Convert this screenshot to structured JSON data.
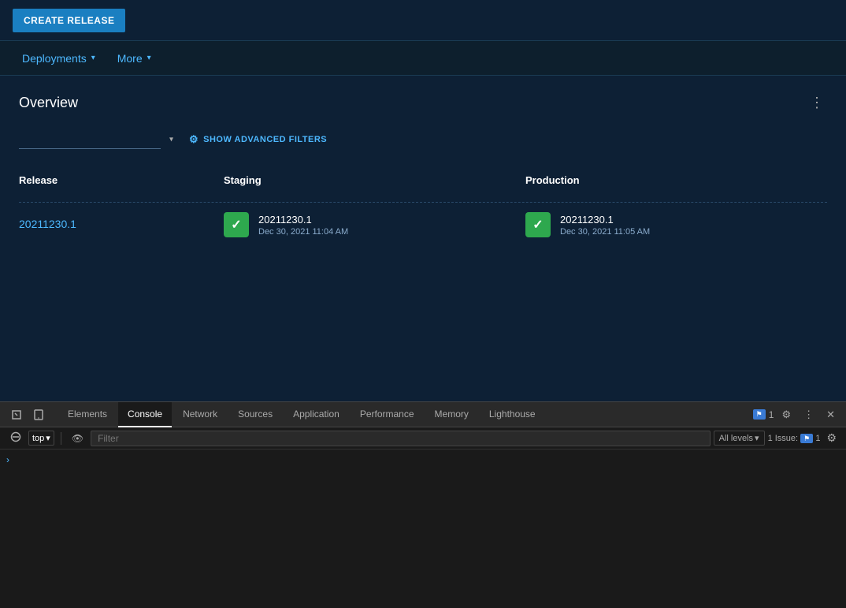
{
  "topbar": {
    "create_release_label": "CREATE RELEASE"
  },
  "navbar": {
    "items": [
      {
        "id": "deployments",
        "label": "Deployments",
        "hasDropdown": true
      },
      {
        "id": "more",
        "label": "More",
        "hasDropdown": true
      }
    ]
  },
  "overview": {
    "title": "Overview",
    "filters": {
      "dropdown_placeholder": "",
      "advanced_filters_label": "SHOW ADVANCED FILTERS"
    },
    "table": {
      "headers": [
        "Release",
        "Staging",
        "Production"
      ],
      "rows": [
        {
          "release": "20211230.1",
          "staging": {
            "version": "20211230.1",
            "date": "Dec 30, 2021 11:04 AM",
            "status": "success"
          },
          "production": {
            "version": "20211230.1",
            "date": "Dec 30, 2021 11:05 AM",
            "status": "success"
          }
        }
      ]
    }
  },
  "devtools": {
    "tabs": [
      {
        "id": "elements",
        "label": "Elements",
        "active": false
      },
      {
        "id": "console",
        "label": "Console",
        "active": true
      },
      {
        "id": "network",
        "label": "Network",
        "active": false
      },
      {
        "id": "sources",
        "label": "Sources",
        "active": false
      },
      {
        "id": "application",
        "label": "Application",
        "active": false
      },
      {
        "id": "performance",
        "label": "Performance",
        "active": false
      },
      {
        "id": "memory",
        "label": "Memory",
        "active": false
      },
      {
        "id": "lighthouse",
        "label": "Lighthouse",
        "active": false
      }
    ],
    "issues_count": "1",
    "console_toolbar": {
      "top_selector": "top",
      "filter_placeholder": "Filter",
      "all_levels": "All levels",
      "issue_label": "1 Issue:",
      "issue_count": "1"
    }
  },
  "colors": {
    "accent": "#1a7fc1",
    "link": "#4db8ff",
    "success": "#2ea84e",
    "bg_dark": "#0d1f2d",
    "bg_mid": "#0d2035",
    "devtools_bg": "#1a1a1a"
  }
}
